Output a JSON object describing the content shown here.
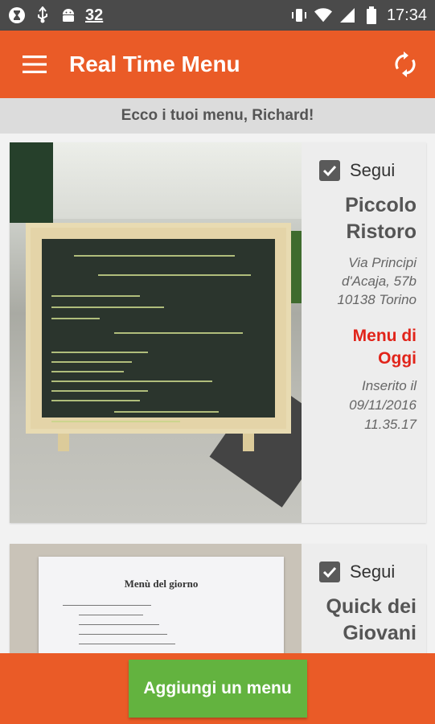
{
  "status_bar": {
    "notification_count": "32",
    "time": "17:34"
  },
  "app_bar": {
    "title": "Real Time Menu"
  },
  "greeting": "Ecco i tuoi menu, Richard!",
  "cards": [
    {
      "follow_label": "Segui",
      "followed": true,
      "restaurant_name": "Piccolo Ristoro",
      "address": "Via Principi d'Acaja, 57b 10138 Torino",
      "menu_title": "Menu di Oggi",
      "inserted": "Inserito il 09/11/2016 11.35.17"
    },
    {
      "follow_label": "Segui",
      "followed": true,
      "restaurant_name": "Quick dei Giovani",
      "photo_title": "Menù del giorno"
    }
  ],
  "bottom": {
    "add_button_label": "Aggiungi un menu"
  },
  "colors": {
    "primary": "#ea5b27",
    "button_green": "#63b33f",
    "menu_title_red": "#e1241a"
  }
}
